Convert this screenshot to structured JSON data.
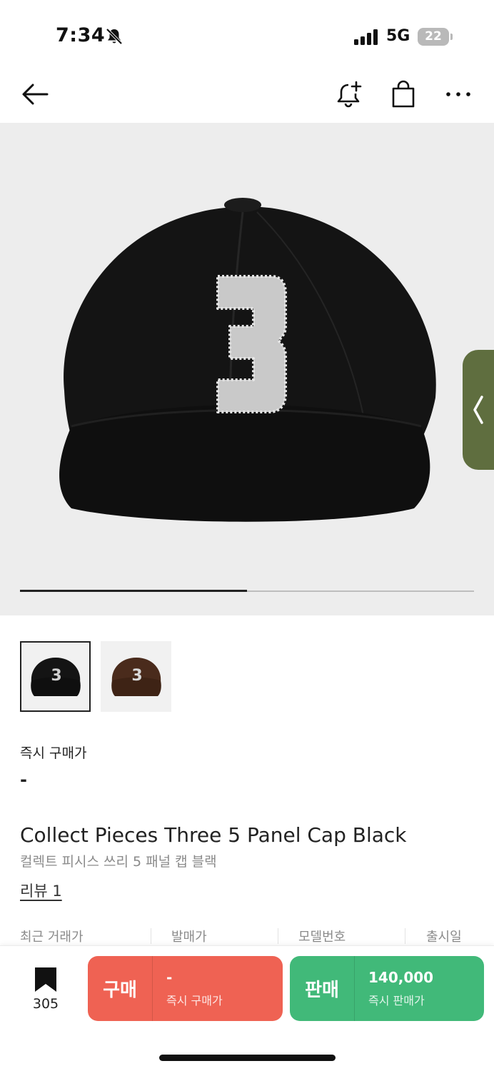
{
  "status_bar": {
    "time": "7:34",
    "network": "5G",
    "battery": "22",
    "icons": [
      "bell-slash-icon",
      "signal-bars-icon",
      "battery-icon"
    ]
  },
  "nav": {
    "icons": [
      "back-arrow-icon",
      "bell-plus-icon",
      "shopping-bag-icon",
      "more-horizontal-icon"
    ]
  },
  "gallery": {
    "image_progress": 0.5,
    "cap_number": "3",
    "side_tab_color": "#5f6e3f"
  },
  "thumbnails": [
    {
      "color": "black",
      "number": "3",
      "selected": true
    },
    {
      "color": "brown",
      "number": "3",
      "selected": false
    }
  ],
  "instant_price": {
    "label": "즉시 구매가",
    "value": "-"
  },
  "product": {
    "title_en": "Collect Pieces Three 5 Panel Cap Black",
    "title_ko": "컬렉트 피시스 쓰리 5 패널 캡 블랙",
    "review_link": "리뷰 1"
  },
  "info_columns": [
    "최근 거래가",
    "발매가",
    "모델번호",
    "출시일"
  ],
  "bottom_bar": {
    "wish_count": "305",
    "buy": {
      "label": "구매",
      "price": "-",
      "sub": "즉시 구매가",
      "color": "#ef6253"
    },
    "sell": {
      "label": "판매",
      "price": "140,000",
      "sub": "즉시 판매가",
      "color": "#41b979"
    }
  }
}
